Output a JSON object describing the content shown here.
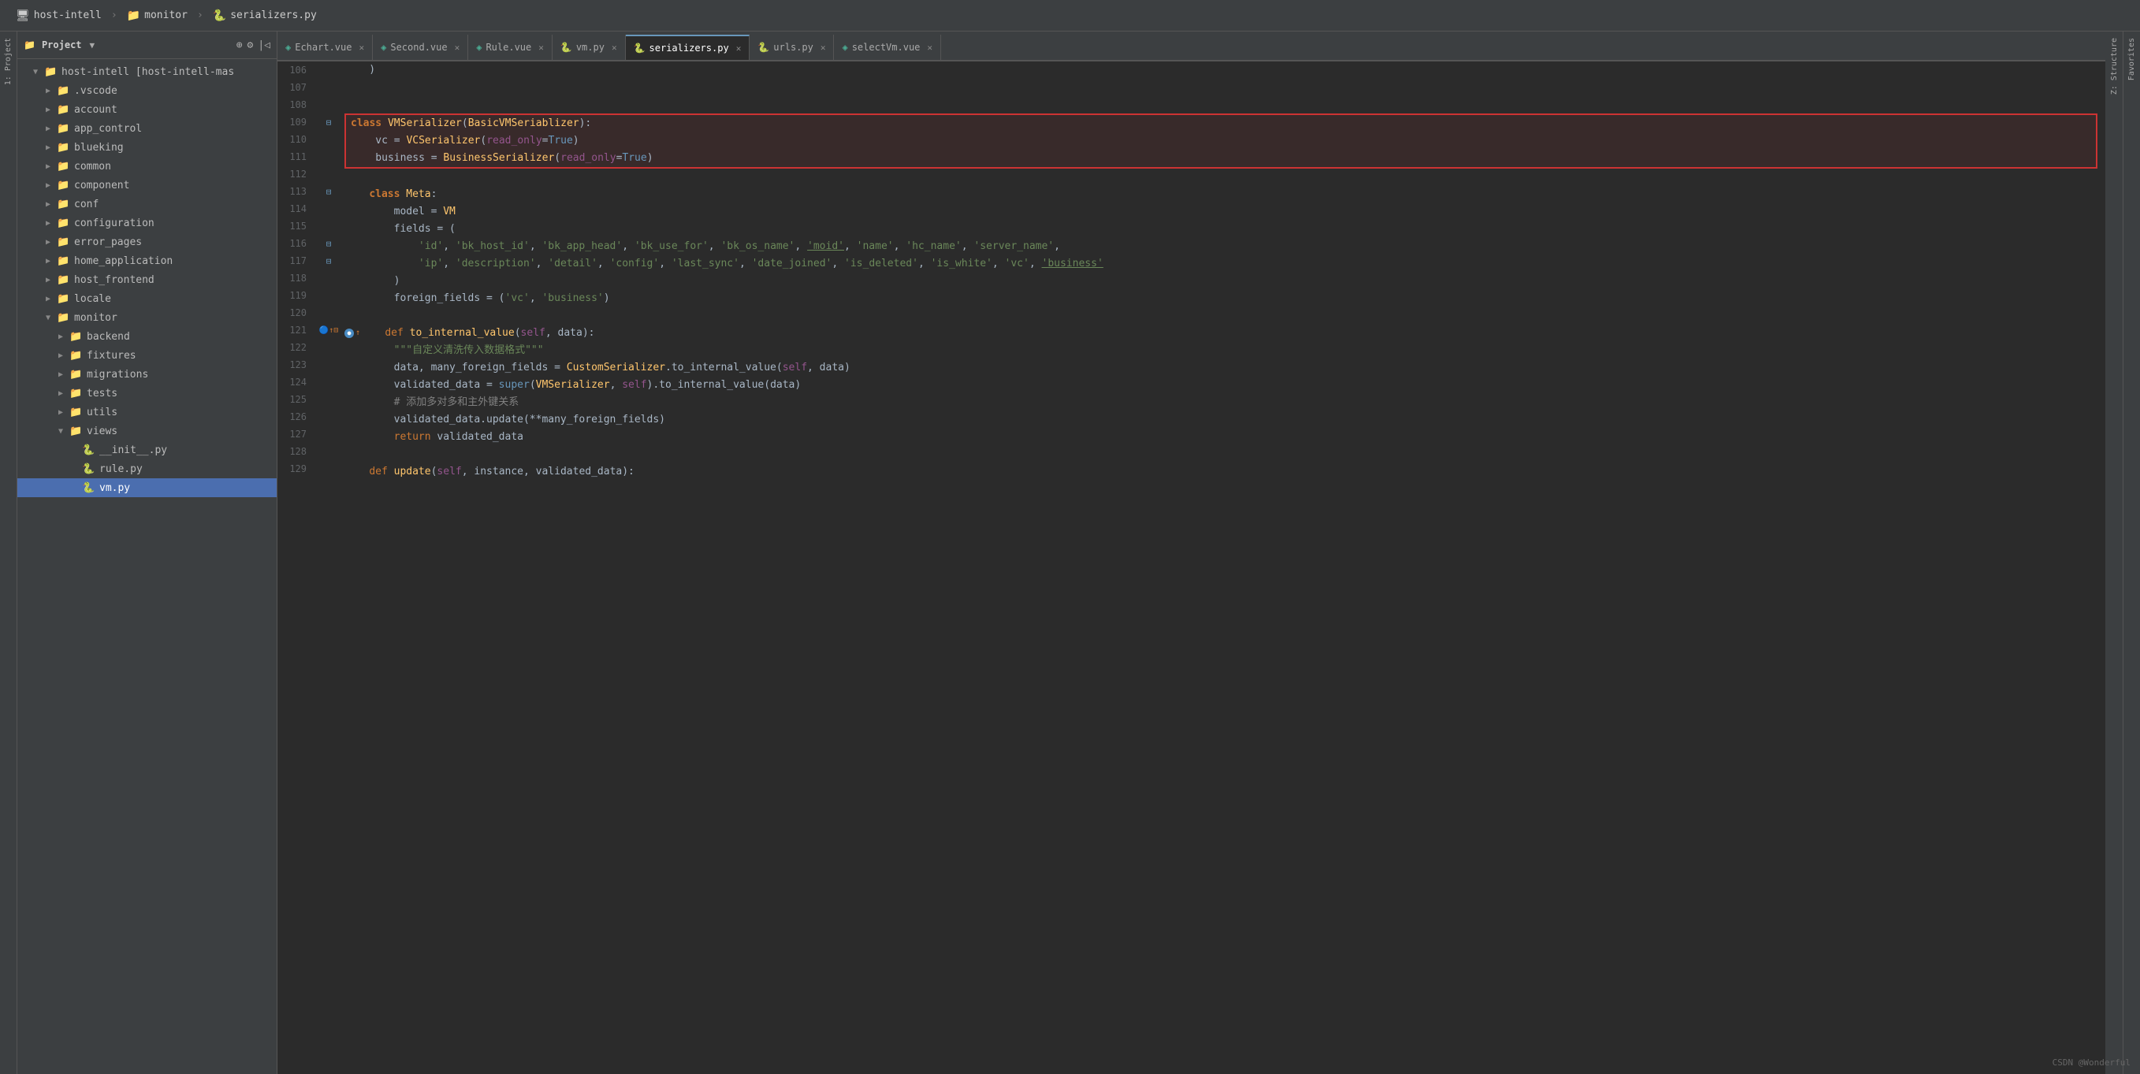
{
  "titlebar": {
    "items": [
      {
        "icon": "🖥",
        "label": "host-intell"
      },
      {
        "icon": "📁",
        "label": "monitor"
      },
      {
        "icon": "🐍",
        "label": "serializers.py"
      }
    ]
  },
  "panel": {
    "title": "Project",
    "tree": [
      {
        "indent": 1,
        "type": "folder-open",
        "label": "host-intell [host-intell-mas",
        "expanded": true
      },
      {
        "indent": 2,
        "type": "folder",
        "label": ".vscode"
      },
      {
        "indent": 2,
        "type": "folder",
        "label": "account"
      },
      {
        "indent": 2,
        "type": "folder",
        "label": "app_control"
      },
      {
        "indent": 2,
        "type": "folder",
        "label": "blueking"
      },
      {
        "indent": 2,
        "type": "folder",
        "label": "common"
      },
      {
        "indent": 2,
        "type": "folder",
        "label": "component"
      },
      {
        "indent": 2,
        "type": "folder",
        "label": "conf"
      },
      {
        "indent": 2,
        "type": "folder",
        "label": "configuration"
      },
      {
        "indent": 2,
        "type": "folder",
        "label": "error_pages"
      },
      {
        "indent": 2,
        "type": "folder",
        "label": "home_application"
      },
      {
        "indent": 2,
        "type": "folder-orange",
        "label": "host_frontend"
      },
      {
        "indent": 2,
        "type": "folder",
        "label": "locale"
      },
      {
        "indent": 2,
        "type": "folder-open",
        "label": "monitor",
        "expanded": true
      },
      {
        "indent": 3,
        "type": "folder",
        "label": "backend"
      },
      {
        "indent": 3,
        "type": "folder",
        "label": "fixtures"
      },
      {
        "indent": 3,
        "type": "folder",
        "label": "migrations"
      },
      {
        "indent": 3,
        "type": "folder",
        "label": "tests"
      },
      {
        "indent": 3,
        "type": "folder",
        "label": "utils"
      },
      {
        "indent": 3,
        "type": "folder-open",
        "label": "views",
        "expanded": true
      },
      {
        "indent": 4,
        "type": "py",
        "label": "__init__.py"
      },
      {
        "indent": 4,
        "type": "py",
        "label": "rule.py"
      },
      {
        "indent": 4,
        "type": "py",
        "label": "vm.py",
        "selected": true
      }
    ]
  },
  "tabs": [
    {
      "icon": "vue",
      "label": "Echart.vue",
      "active": false
    },
    {
      "icon": "vue",
      "label": "Second.vue",
      "active": false
    },
    {
      "icon": "vue",
      "label": "Rule.vue",
      "active": false
    },
    {
      "icon": "py",
      "label": "vm.py",
      "active": false
    },
    {
      "icon": "py",
      "label": "serializers.py",
      "active": true
    },
    {
      "icon": "py",
      "label": "urls.py",
      "active": false
    },
    {
      "icon": "vue",
      "label": "selectVm.vue",
      "active": false
    }
  ],
  "lines": [
    {
      "num": "106",
      "gutter": "",
      "code": "    )"
    },
    {
      "num": "107",
      "gutter": "",
      "code": ""
    },
    {
      "num": "108",
      "gutter": "",
      "code": ""
    },
    {
      "num": "109",
      "gutter": "⊟",
      "code": "class VMSerializer(BasicVMSeriablizer):",
      "highlight": true
    },
    {
      "num": "110",
      "gutter": "",
      "code": "    vc = VCSerializer(read_only=True)",
      "highlight": true
    },
    {
      "num": "111",
      "gutter": "",
      "code": "    business = BusinessSerializer(read_only=True)",
      "highlight": true
    },
    {
      "num": "112",
      "gutter": "",
      "code": ""
    },
    {
      "num": "113",
      "gutter": "⊟",
      "code": "    class Meta:"
    },
    {
      "num": "114",
      "gutter": "",
      "code": "        model = VM"
    },
    {
      "num": "115",
      "gutter": "",
      "code": "        fields = ("
    },
    {
      "num": "116",
      "gutter": "⊟",
      "code": "            'id', 'bk_host_id', 'bk_app_head', 'bk_use_for', 'bk_os_name', 'moid', 'name', 'hc_name', 'server_name',"
    },
    {
      "num": "117",
      "gutter": "⊟",
      "code": "            'ip', 'description', 'detail', 'config', 'last_sync', 'date_joined', 'is_deleted', 'is_white', 'vc', 'business'"
    },
    {
      "num": "118",
      "gutter": "",
      "code": "        )"
    },
    {
      "num": "119",
      "gutter": "",
      "code": "        foreign_fields = ('vc', 'business')"
    },
    {
      "num": "120",
      "gutter": "",
      "code": ""
    },
    {
      "num": "121",
      "gutter": "⊟↑",
      "code": "    def to_internal_value(self, data):"
    },
    {
      "num": "122",
      "gutter": "",
      "code": "        \"\"\"自定义清洗传入数据格式\"\"\""
    },
    {
      "num": "123",
      "gutter": "",
      "code": "        data, many_foreign_fields = CustomSerializer.to_internal_value(self, data)"
    },
    {
      "num": "124",
      "gutter": "",
      "code": "        validated_data = super(VMSerializer, self).to_internal_value(data)"
    },
    {
      "num": "125",
      "gutter": "",
      "code": "        # 添加多对多和主外键关系"
    },
    {
      "num": "126",
      "gutter": "",
      "code": "        validated_data.update(**many_foreign_fields)"
    },
    {
      "num": "127",
      "gutter": "",
      "code": "        return validated_data"
    },
    {
      "num": "128",
      "gutter": "",
      "code": ""
    },
    {
      "num": "129",
      "gutter": "",
      "code": "    def update(self, instance, validated_data):"
    }
  ],
  "watermark": "CSDN @Wonderful"
}
